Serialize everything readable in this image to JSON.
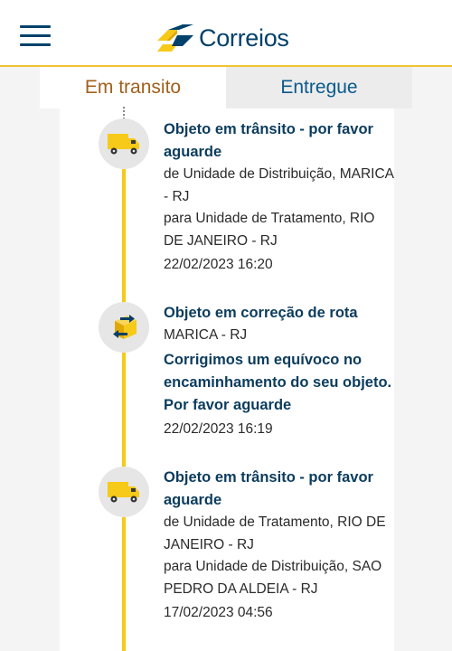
{
  "header": {
    "logo_text": "Correios",
    "menu_icon": "hamburger-menu-icon",
    "brand_blue": "#00416b",
    "brand_yellow": "#f7c918"
  },
  "tabs": [
    {
      "label": "Em transito",
      "active": true
    },
    {
      "label": "Entregue",
      "active": false
    }
  ],
  "events": [
    {
      "icon": "truck-icon",
      "title": "Objeto em trânsito - por favor aguarde",
      "from": "de Unidade de Distribuição, MARICA - RJ",
      "to": "para Unidade de Tratamento, RIO DE JANEIRO - RJ",
      "datetime": "22/02/2023 16:20"
    },
    {
      "icon": "route-correction-icon",
      "title": "Objeto em correção de rota",
      "location": "MARICA - RJ",
      "note": "Corrigimos um equívoco no encaminhamento do seu objeto. Por favor aguarde",
      "datetime": "22/02/2023 16:19"
    },
    {
      "icon": "truck-icon",
      "title": "Objeto em trânsito - por favor aguarde",
      "from": "de Unidade de Tratamento, RIO DE JANEIRO - RJ",
      "to": "para Unidade de Distribuição, SAO PEDRO DA ALDEIA - RJ",
      "datetime": "17/02/2023 04:56"
    }
  ]
}
